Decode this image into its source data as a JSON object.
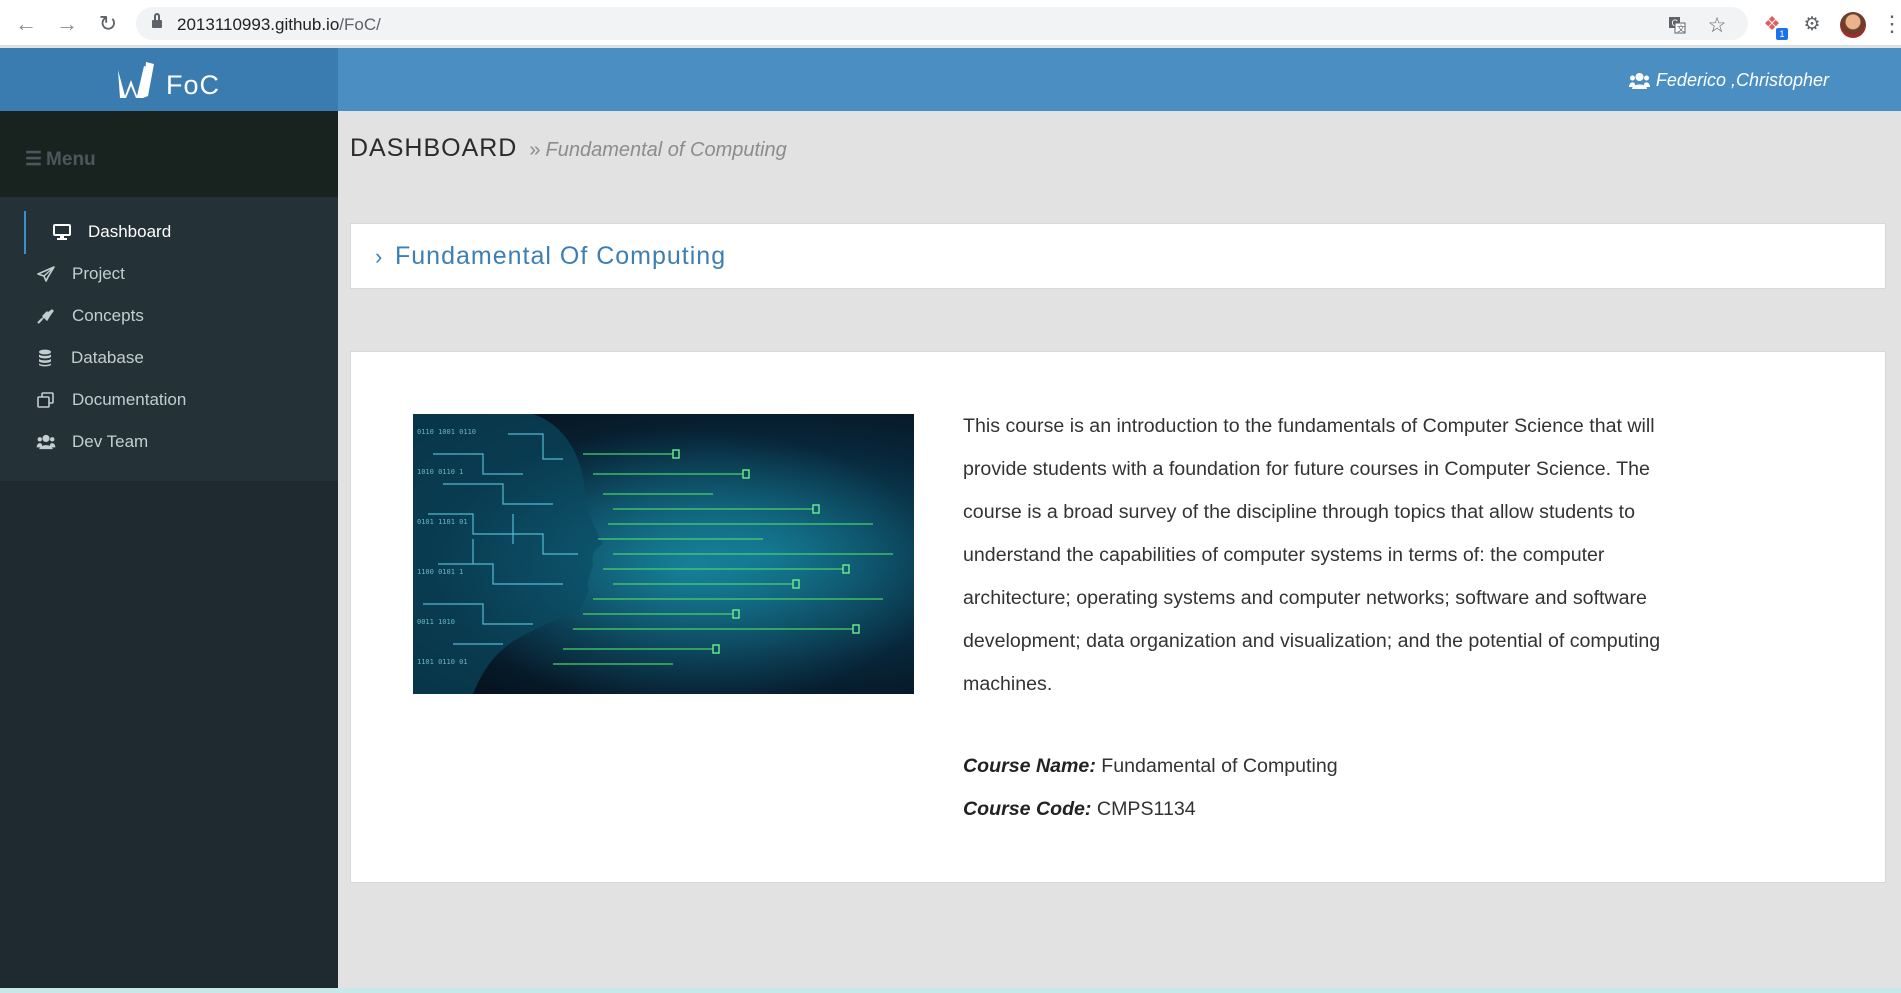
{
  "browser": {
    "url_host": "2013110993.github.io",
    "url_path": "/FoC/",
    "extension_badge": "1",
    "icons": [
      "back-arrow-icon",
      "forward-arrow-icon",
      "reload-icon",
      "lock-icon",
      "translate-icon",
      "star-icon",
      "extension-icon",
      "puzzle-icon",
      "profile-avatar",
      "menu-dots-icon"
    ]
  },
  "header": {
    "brand_name": "FoC",
    "user_name": "Federico ,Christopher",
    "colors": {
      "brand_bg": "#3b7cb0",
      "header_bg": "#4b8ec2"
    }
  },
  "sidebar": {
    "menu_title": "Menu",
    "items": [
      {
        "label": "Dashboard",
        "icon": "monitor-icon",
        "active": true
      },
      {
        "label": "Project",
        "icon": "paper-plane-icon"
      },
      {
        "label": "Concepts",
        "icon": "plug-icon"
      },
      {
        "label": "Database",
        "icon": "database-icon"
      },
      {
        "label": "Documentation",
        "icon": "copy-icon"
      },
      {
        "label": "Dev Team",
        "icon": "users-icon"
      }
    ],
    "colors": {
      "bg": "#1e2a2f",
      "accent": "#3b8ed0"
    }
  },
  "breadcrumb": {
    "main": "DASHBOARD",
    "separator": "»",
    "sub": "Fundamental of Computing"
  },
  "section": {
    "title": "Fundamental Of Computing"
  },
  "course": {
    "description": "This course is an introduction to the fundamentals of Computer Science that will provide students with a foundation for future courses in Computer Science. The course is a broad survey of the discipline through topics that allow students to understand the capabilities of computer systems in terms of: the computer architecture; operating systems and computer networks; software and software development; data organization and visualization; and the potential of computing machines.",
    "name_label": "Course Name:",
    "name_value": "Fundamental of Computing",
    "code_label": "Course Code:",
    "code_value": "CMPS1134"
  }
}
